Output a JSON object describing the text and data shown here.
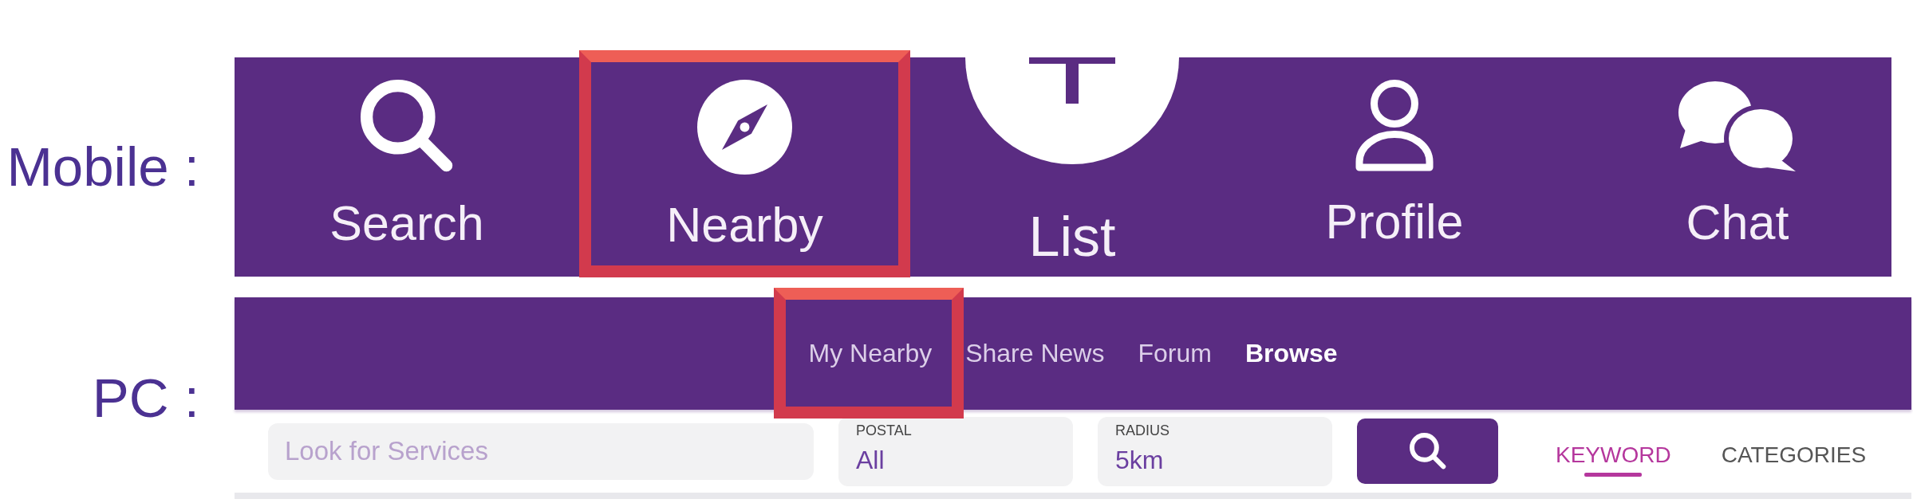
{
  "mobile": {
    "label": "Mobile :",
    "tabs": [
      {
        "label": "Search",
        "kind": "plain",
        "highlighted": false
      },
      {
        "label": "Nearby",
        "kind": "plain",
        "highlighted": true
      },
      {
        "label": "List",
        "kind": "raised",
        "highlighted": false
      },
      {
        "label": "Profile",
        "kind": "plain",
        "highlighted": false
      },
      {
        "label": "Chat",
        "kind": "plain",
        "highlighted": false
      }
    ]
  },
  "pc": {
    "label": "PC :",
    "nav": [
      {
        "label": "My Nearby",
        "selected": false,
        "highlighted": true
      },
      {
        "label": "Share News",
        "selected": false,
        "highlighted": false
      },
      {
        "label": "Forum",
        "selected": false,
        "highlighted": false
      },
      {
        "label": "Browse",
        "selected": true,
        "highlighted": false
      }
    ],
    "search": {
      "placeholder": "Look for Services"
    },
    "filters": [
      {
        "label": "POSTAL",
        "value": "All"
      },
      {
        "label": "RADIUS",
        "value": "5km"
      }
    ],
    "modes": [
      {
        "label": "KEYWORD",
        "selected": true
      },
      {
        "label": "CATEGORIES",
        "selected": false
      }
    ]
  }
}
